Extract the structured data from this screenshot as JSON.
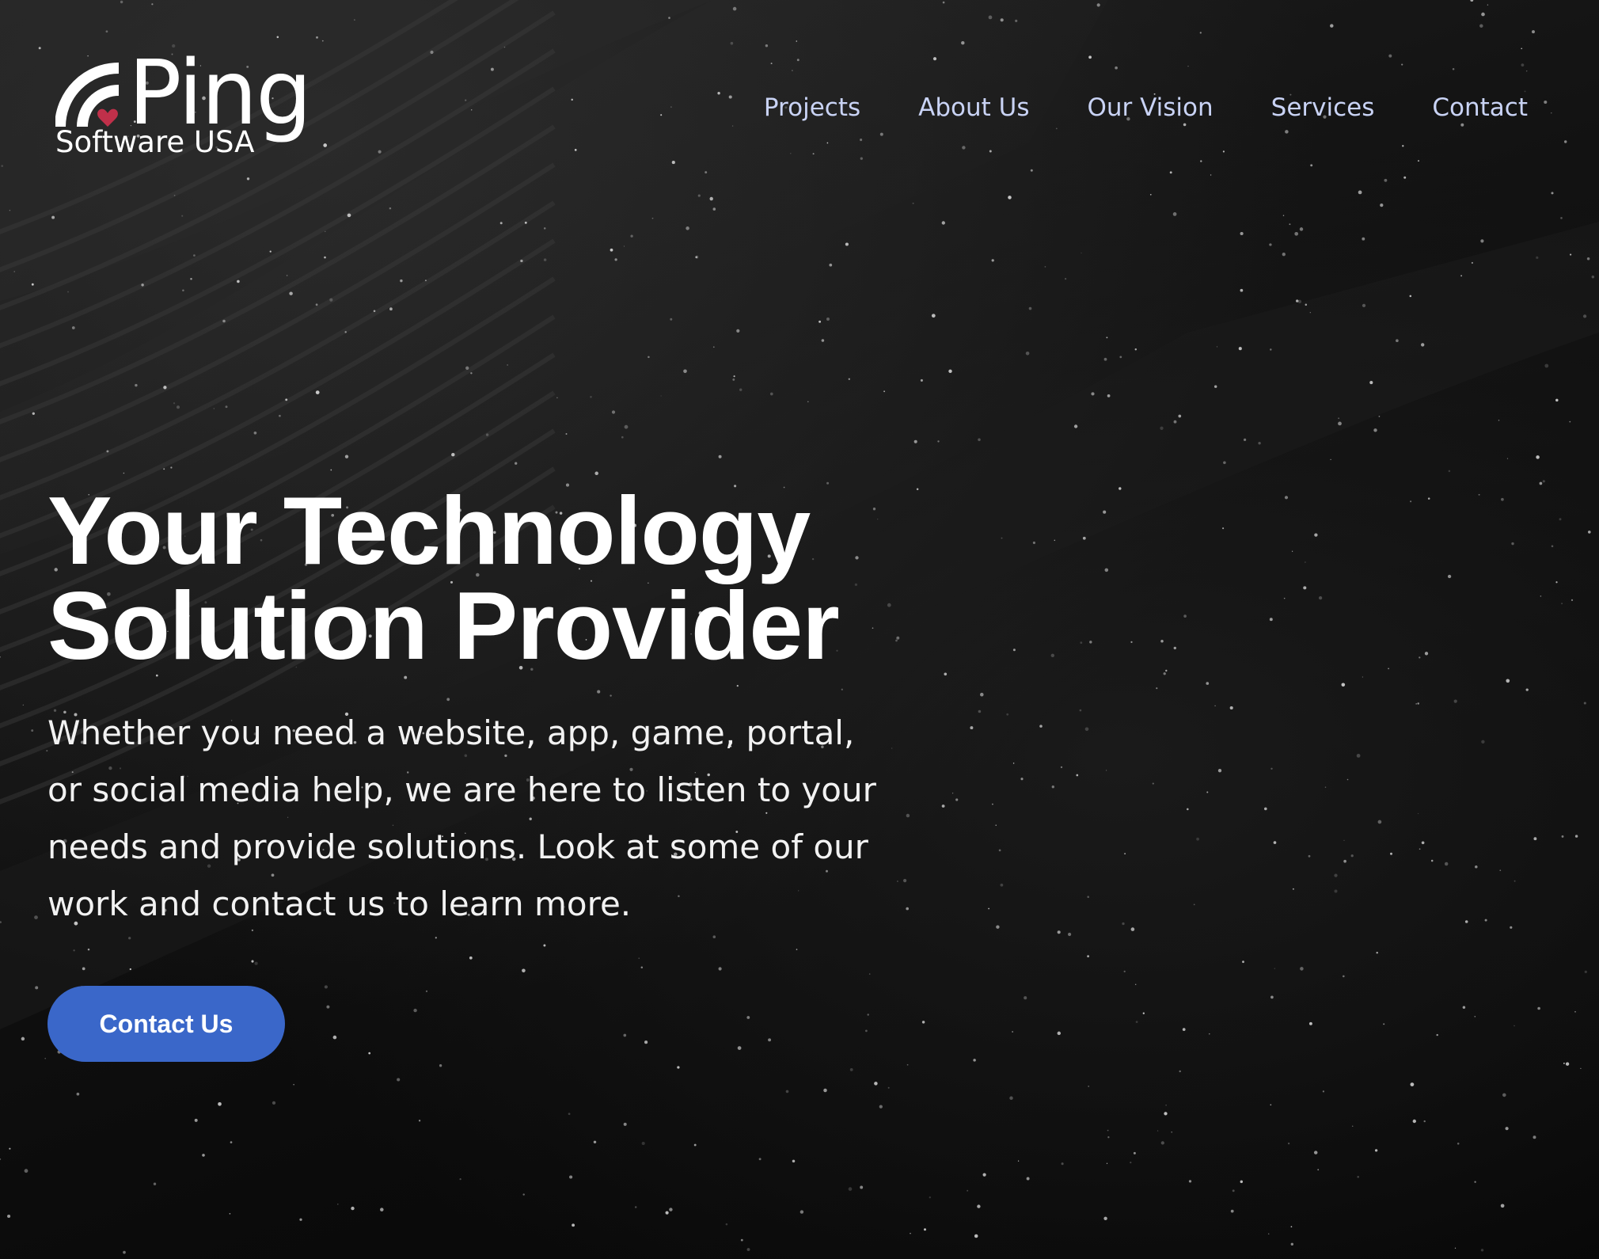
{
  "brand": {
    "name": "Ping",
    "tagline": "Software USA",
    "icon": "signal-heart-icon",
    "accent_color": "#c0304a"
  },
  "nav": {
    "items": [
      {
        "label": "Projects"
      },
      {
        "label": "About Us"
      },
      {
        "label": "Our Vision"
      },
      {
        "label": "Services"
      },
      {
        "label": "Contact"
      }
    ],
    "link_color": "#c9d3f5"
  },
  "hero": {
    "title_line1": "Your Technology",
    "title_line2": "Solution Provider",
    "description": "Whether you need a website, app, game, portal, or social media help, we are here to listen to your needs and provide solutions. Look at some of our work and contact us to learn more.",
    "cta_label": "Contact Us",
    "cta_color": "#3a67c9"
  },
  "background": {
    "description_color": "#0a0a0a"
  }
}
